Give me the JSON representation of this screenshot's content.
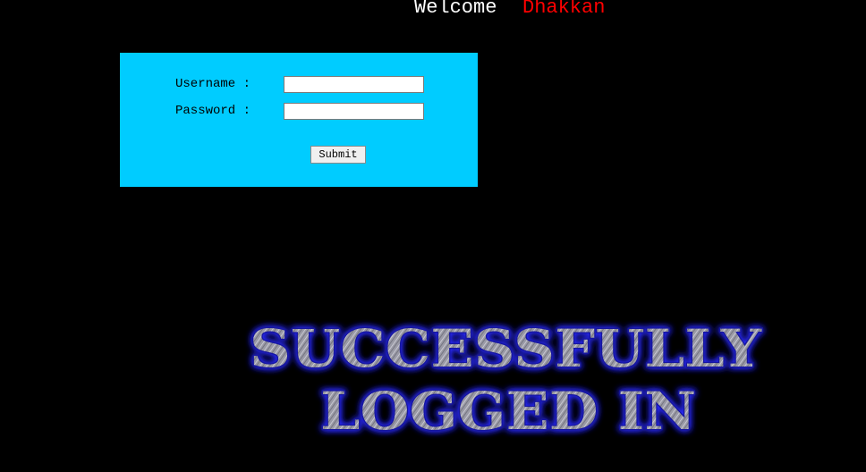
{
  "header": {
    "welcome_text": "Welcome",
    "user_name": "Dhakkan"
  },
  "login_form": {
    "username_label": "Username :",
    "password_label": "Password :",
    "username_value": "",
    "password_value": "",
    "submit_label": "Submit",
    "box_color": "#00ccff"
  },
  "result_banner": {
    "line1": "SUCCESSFULLY",
    "line2": "LOGGED IN"
  },
  "colors": {
    "background": "#000000",
    "welcome": "#ffffff",
    "user_name": "#ff0000",
    "banner_glow": "#1a1aff"
  }
}
